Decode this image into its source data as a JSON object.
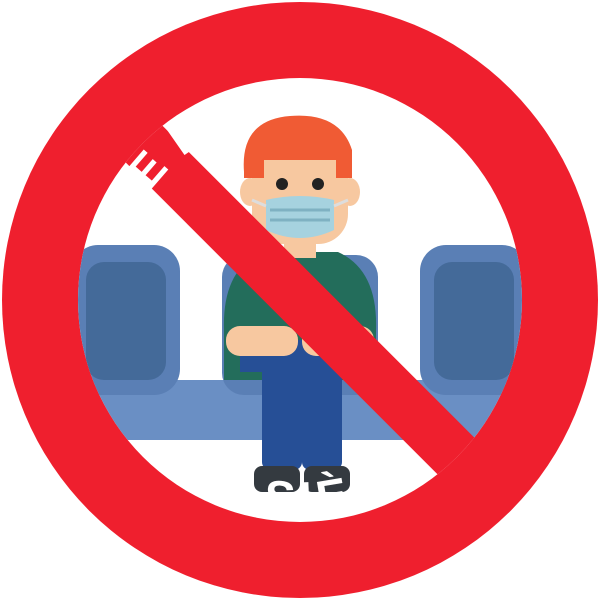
{
  "sign": {
    "top_text": "NE PAS UTILISER",
    "bottom_text": "CE SIÈGE",
    "icon": "no-sitting-prohibition-icon"
  },
  "colors": {
    "ring": "#ef1f2e",
    "background": "#ffffff",
    "text": "#ffffff",
    "seat_back": "#5a7fb5",
    "seat_inner": "#446a99",
    "seat_base": "#6a8fc4",
    "hair": "#f05b34",
    "skin": "#f7c8a0",
    "mask": "#a6d2df",
    "shirt": "#236d5b",
    "pants": "#264f96",
    "shoes": "#343a40"
  }
}
